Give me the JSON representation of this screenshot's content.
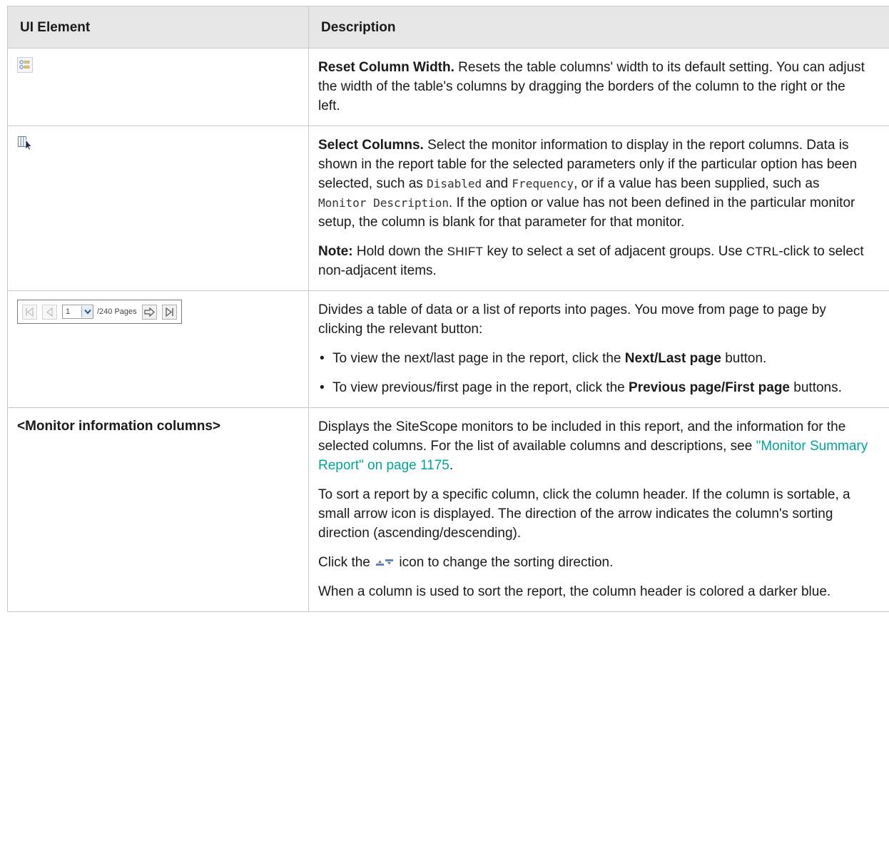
{
  "header": {
    "col1": "UI Element",
    "col2": "Description"
  },
  "rows": {
    "reset": {
      "icon": "reset-column-width-icon",
      "title": "Reset Column Width.",
      "text": " Resets the table columns' width to its default setting. You can adjust the width of the table's columns by dragging the borders of the column to the right or the left."
    },
    "select": {
      "icon": "select-columns-icon",
      "title": "Select Columns.",
      "t1": " Select the monitor information to display in the report columns. Data is shown in the report table for the selected parameters only if the particular option has been selected, such as ",
      "code1": "Disabled",
      "t2": " and ",
      "code2": "Frequency",
      "t3": ", or if a value has been supplied, such as ",
      "code3": "Monitor Description",
      "t4": ". If the option or value has not been defined in the particular monitor setup, the column is blank for that parameter for that monitor.",
      "note_label": "Note:",
      "note_t1": " Hold down the ",
      "note_key1": "SHIFT",
      "note_t2": " key to select a set of adjacent groups. Use ",
      "note_key2": "CTRL",
      "note_t3": "-click to select non-adjacent items."
    },
    "pager": {
      "page_value": "1",
      "pages_text": "/240 Pages",
      "intro": "Divides a table of data or a list of reports into pages. You move from page to page by clicking the relevant button:",
      "b1_t1": "To view the next/last page in the report, click the ",
      "b1_bold": "Next/Last page",
      "b1_t2": " button.",
      "b2_t1": "To view previous/first page in the report, click the ",
      "b2_bold": "Previous page/First page",
      "b2_t2": " buttons."
    },
    "monitor": {
      "element": "<Monitor information columns>",
      "p1_t1": "Displays the SiteScope monitors to be included in this report, and the information for the selected columns. For the list of available columns and descriptions, see ",
      "p1_link": "\"Monitor Summary Report\" on page 1175",
      "p1_t2": ".",
      "p2": "To sort a report by a specific column, click the column header. If the column is sortable, a small arrow icon is displayed. The direction of the arrow indicates the column's sorting direction (ascending/descending).",
      "p3_t1": "Click the ",
      "p3_t2": " icon to change the sorting direction.",
      "p4": "When a column is used to sort the report, the column header is colored a darker blue."
    }
  },
  "colors": {
    "header_bg": "#e6e6e6",
    "border": "#c9c9c9",
    "link": "#00a59c"
  }
}
